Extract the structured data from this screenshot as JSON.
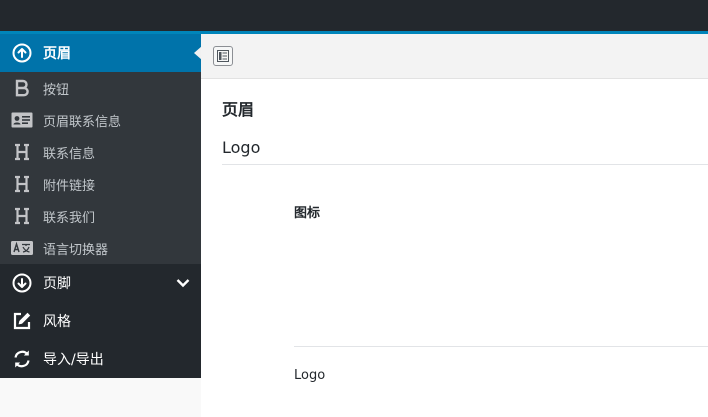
{
  "sidebar": {
    "active": {
      "label": "页眉",
      "icon": "arrow-up-circle-icon"
    },
    "submenu": [
      {
        "label": "按钮",
        "icon": "bold-b-icon"
      },
      {
        "label": "页眉联系信息",
        "icon": "id-card-icon"
      },
      {
        "label": "联系信息",
        "icon": "heading-h-icon"
      },
      {
        "label": "附件链接",
        "icon": "heading-h-icon"
      },
      {
        "label": "联系我们",
        "icon": "heading-h-icon"
      },
      {
        "label": "语言切换器",
        "icon": "translate-icon"
      }
    ],
    "lower": [
      {
        "label": "页脚",
        "icon": "arrow-down-circle-icon"
      },
      {
        "label": "风格",
        "icon": "edit-icon"
      },
      {
        "label": "导入/导出",
        "icon": "sync-icon"
      }
    ]
  },
  "content": {
    "section_title": "页眉",
    "subsection_title": "Logo",
    "field_icon_label": "图标",
    "field_logo_label": "Logo"
  },
  "colors": {
    "topbar": "#23282d",
    "accent": "#0085ba",
    "active_menu": "#0073aa",
    "sidebar": "#32373c"
  }
}
